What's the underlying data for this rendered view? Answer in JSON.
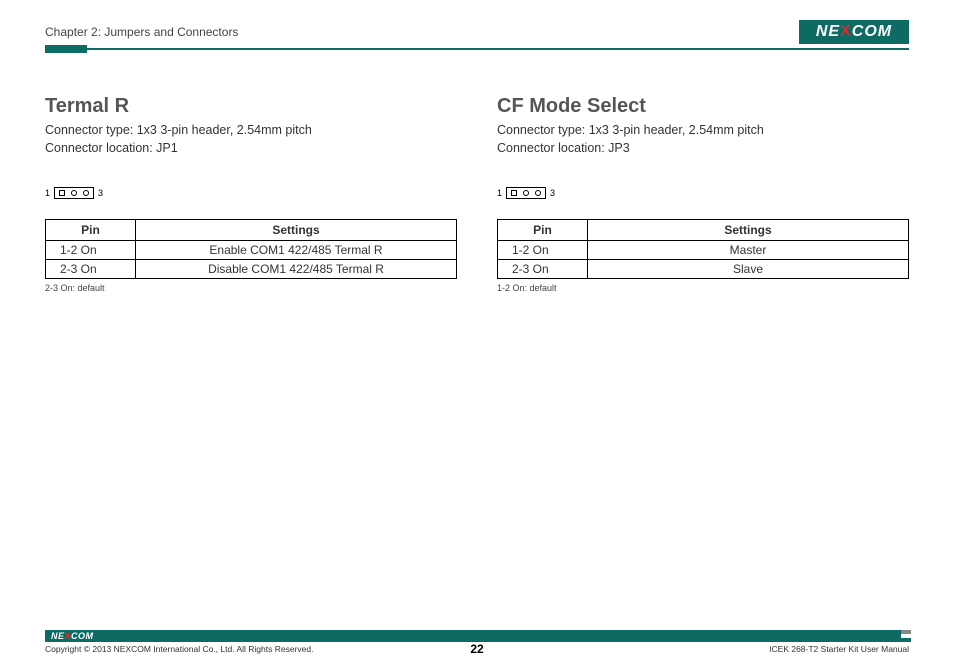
{
  "header": {
    "chapter": "Chapter 2: Jumpers and Connectors",
    "logo_text_pre": "NE",
    "logo_text_x": "X",
    "logo_text_post": "COM"
  },
  "sections": [
    {
      "title": "Termal R",
      "conn_type": "Connector type: 1x3 3-pin header, 2.54mm pitch",
      "conn_loc": "Connector location: JP1",
      "pin_left": "1",
      "pin_right": "3",
      "th_pin": "Pin",
      "th_set": "Settings",
      "rows": [
        {
          "pin": "1-2 On",
          "setting": "Enable COM1 422/485 Termal R"
        },
        {
          "pin": "2-3 On",
          "setting": "Disable COM1 422/485 Termal R"
        }
      ],
      "note": "2-3 On: default"
    },
    {
      "title": "CF Mode Select",
      "conn_type": "Connector type: 1x3 3-pin header, 2.54mm pitch",
      "conn_loc": "Connector location: JP3",
      "pin_left": "1",
      "pin_right": "3",
      "th_pin": "Pin",
      "th_set": "Settings",
      "rows": [
        {
          "pin": "1-2 On",
          "setting": "Master"
        },
        {
          "pin": "2-3 On",
          "setting": "Slave"
        }
      ],
      "note": "1-2 On: default"
    }
  ],
  "footer": {
    "copyright": "Copyright © 2013 NEXCOM International Co., Ltd. All Rights Reserved.",
    "page": "22",
    "manual": "ICEK 268-T2 Starter Kit User Manual"
  }
}
